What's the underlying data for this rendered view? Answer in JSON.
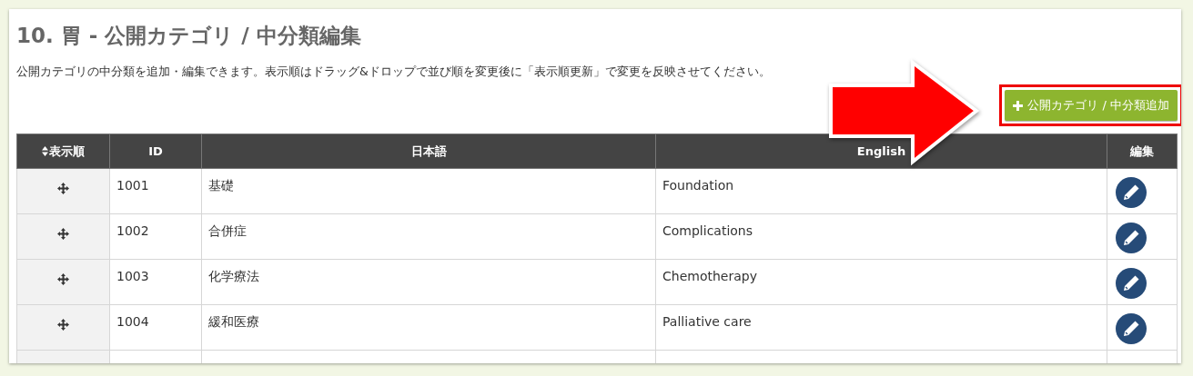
{
  "title": "10. 胃 - 公開カテゴリ / 中分類編集",
  "description": "公開カテゴリの中分類を追加・編集できます。表示順はドラッグ&ドロップで並び順を変更後に「表示順更新」で変更を反映させてください。",
  "add_button": {
    "label": "公開カテゴリ / 中分類追加"
  },
  "table": {
    "columns": [
      "表示順",
      "ID",
      "日本語",
      "English",
      "編集"
    ],
    "rows": [
      {
        "id": "1001",
        "japanese": "基礎",
        "english": "Foundation"
      },
      {
        "id": "1002",
        "japanese": "合併症",
        "english": "Complications"
      },
      {
        "id": "1003",
        "japanese": "化学療法",
        "english": "Chemotherapy"
      },
      {
        "id": "1004",
        "japanese": "緩和医療",
        "english": "Palliative care"
      }
    ]
  }
}
